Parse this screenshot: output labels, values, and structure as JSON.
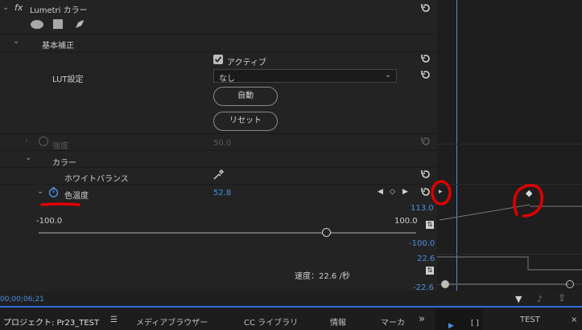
{
  "effect": {
    "fx": "fx",
    "name": "Lumetri カラー"
  },
  "basic": {
    "section": "基本補正"
  },
  "active_label": "アクティブ",
  "lut": {
    "label": "LUT設定",
    "value": "なし"
  },
  "buttons": {
    "auto": "自動",
    "reset": "リセット"
  },
  "intensity": {
    "label": "強度",
    "value": "50.0"
  },
  "color": {
    "section": "カラー"
  },
  "white_balance": {
    "label": "ホワイトバランス"
  },
  "temperature": {
    "label": "色温度",
    "value": "52.8",
    "min": "-100.0",
    "max": "100.0",
    "slider_fraction": 0.764,
    "graph_top": "113.0",
    "graph_bottom": "-100.0",
    "speed_top": "22.6",
    "speed_bottom": "-22.6",
    "speed_label": "速度：22.6 /秒"
  },
  "timecode": "00;00;06;21",
  "tabs": {
    "project": "プロジェクト: Pr23_TEST",
    "media_browser": "メディアブラウザー",
    "cc_libraries": "CC ライブラリ",
    "info": "情報",
    "markers": "マーカ",
    "more": "»",
    "program": "TEST"
  },
  "colors": {
    "accent_blue": "#4a90e2",
    "annotation_red": "#e00000",
    "panel_bg": "#232323"
  }
}
